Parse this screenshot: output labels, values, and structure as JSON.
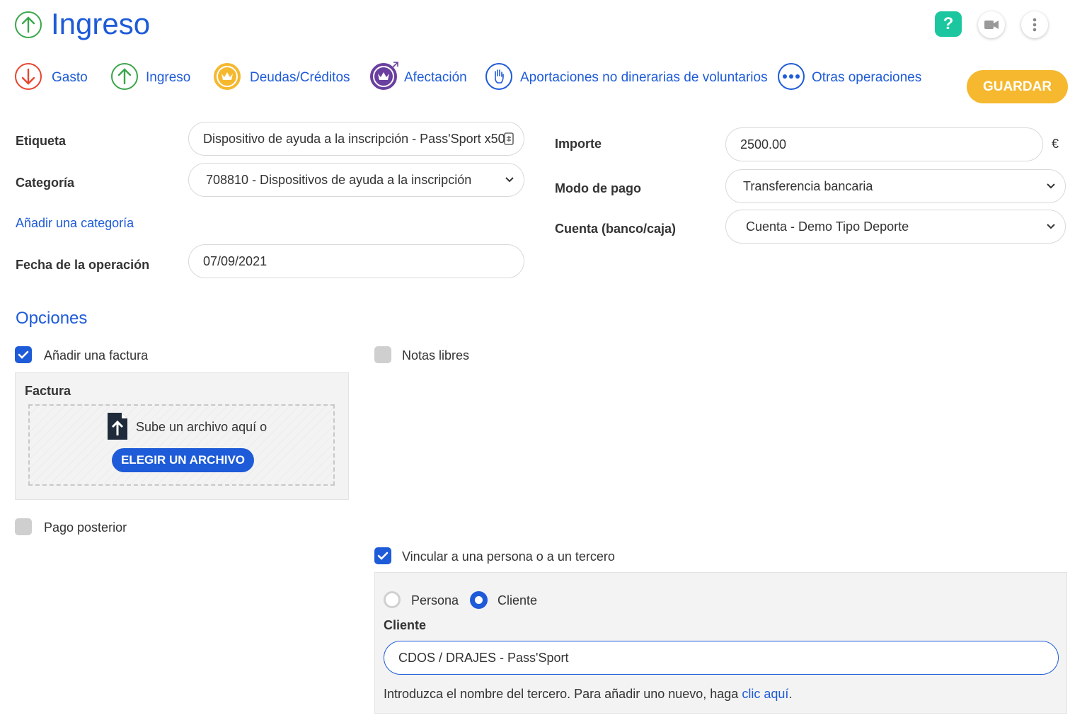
{
  "header": {
    "title": "Ingreso",
    "help_label": "?"
  },
  "nav": {
    "gasto": "Gasto",
    "ingreso": "Ingreso",
    "deudas": "Deudas/Créditos",
    "afectacion": "Afectación",
    "aportaciones": "Aportaciones no dinerarias de voluntarios",
    "otras": "Otras operaciones",
    "guardar": "GUARDAR"
  },
  "form": {
    "etiqueta_label": "Etiqueta",
    "etiqueta_value": "Dispositivo de ayuda a la inscripción - Pass'Sport x50",
    "categoria_label": "Categoría",
    "categoria_value": "708810 - Dispositivos de ayuda a la inscripción",
    "add_categoria": "Añadir una categoría",
    "fecha_label": "Fecha de la operación",
    "fecha_value": "07/09/2021",
    "importe_label": "Importe",
    "importe_value": "2500.00",
    "currency": "€",
    "modo_label": "Modo de pago",
    "modo_value": "Transferencia bancaria",
    "cuenta_label": "Cuenta (banco/caja)",
    "cuenta_value": "Cuenta - Demo Tipo Deporte"
  },
  "options": {
    "title": "Opciones",
    "factura_check": "Añadir una factura",
    "factura_checked": true,
    "notas_check": "Notas libres",
    "notas_checked": false,
    "factura_panel_title": "Factura",
    "upload_text": "Sube un archivo aquí o",
    "upload_button": "ELEGIR UN ARCHIVO",
    "pago_check": "Pago posterior",
    "pago_checked": false,
    "vincular_check": "Vincular a una persona o a un tercero",
    "vincular_checked": true,
    "radio_persona": "Persona",
    "radio_cliente": "Cliente",
    "selected_radio": "Cliente",
    "cliente_label": "Cliente",
    "cliente_value": "CDOS / DRAJES - Pass'Sport",
    "help_prefix": "Introduzca el nombre del tercero. Para añadir uno nuevo, haga",
    "help_link": "clic aquí",
    "help_suffix": "."
  },
  "colors": {
    "primary": "#1e5bd8",
    "accent_yellow": "#f5b82e",
    "help_green": "#1cc7a0",
    "gasto_red": "#e8442e",
    "ingreso_green": "#3aa64a",
    "afectacion_purple": "#6a3fa0"
  }
}
